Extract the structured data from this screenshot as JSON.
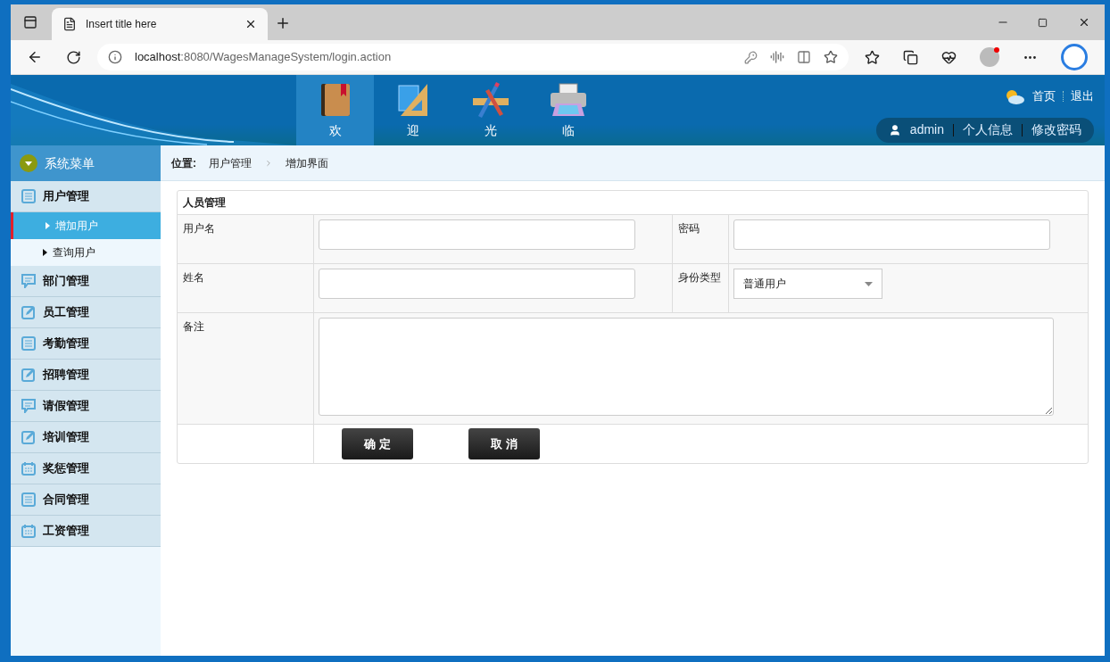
{
  "browser": {
    "tab_title": "Insert title here",
    "url_host": "localhost",
    "url_rest": ":8080/WagesManageSystem/login.action"
  },
  "header": {
    "nav": [
      {
        "label": "欢",
        "selected": true
      },
      {
        "label": "迎",
        "selected": false
      },
      {
        "label": "光",
        "selected": false
      },
      {
        "label": "临",
        "selected": false
      }
    ],
    "top_links": [
      "首页",
      "退出"
    ],
    "user": "admin",
    "user_links": [
      "个人信息",
      "修改密码"
    ]
  },
  "sidebar": {
    "title": "系统菜单",
    "groups": [
      {
        "label": "用户管理",
        "children": [
          {
            "label": "增加用户",
            "selected": true
          },
          {
            "label": "查询用户",
            "selected": false
          }
        ]
      },
      {
        "label": "部门管理"
      },
      {
        "label": "员工管理"
      },
      {
        "label": "考勤管理"
      },
      {
        "label": "招聘管理"
      },
      {
        "label": "请假管理"
      },
      {
        "label": "培训管理"
      },
      {
        "label": "奖惩管理"
      },
      {
        "label": "合同管理"
      },
      {
        "label": "工资管理"
      }
    ]
  },
  "breadcrumb": {
    "label": "位置:",
    "items": [
      "用户管理",
      "增加界面"
    ]
  },
  "form": {
    "title": "人员管理",
    "rows": [
      [
        {
          "label": "用户名",
          "kind": "text"
        },
        {
          "label": "密码",
          "kind": "text"
        }
      ],
      [
        {
          "label": "姓名",
          "kind": "text"
        },
        {
          "label": "身份类型",
          "kind": "select",
          "value": "普通用户"
        }
      ],
      [
        {
          "label": "备注",
          "kind": "textarea"
        }
      ]
    ],
    "buttons": [
      "确 定",
      "取 消"
    ]
  }
}
